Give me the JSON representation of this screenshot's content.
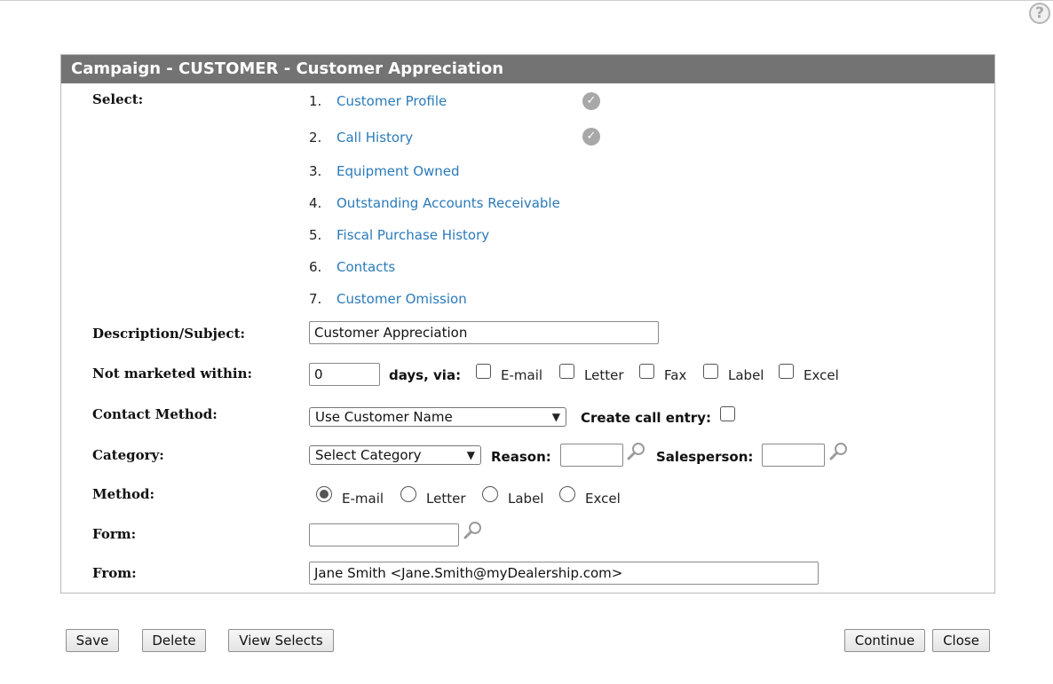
{
  "help": {
    "symbol": "?"
  },
  "panel": {
    "title": "Campaign - CUSTOMER - Customer Appreciation"
  },
  "select": {
    "label": "Select:",
    "items": [
      {
        "num": "1.",
        "label": "Customer Profile",
        "checked": true
      },
      {
        "num": "2.",
        "label": "Call History",
        "checked": true
      },
      {
        "num": "3.",
        "label": "Equipment Owned",
        "checked": false
      },
      {
        "num": "4.",
        "label": "Outstanding Accounts Receivable",
        "checked": false
      },
      {
        "num": "5.",
        "label": "Fiscal Purchase History",
        "checked": false
      },
      {
        "num": "6.",
        "label": "Contacts",
        "checked": false
      },
      {
        "num": "7.",
        "label": "Customer Omission",
        "checked": false
      }
    ]
  },
  "description": {
    "label": "Description/Subject:",
    "value": "Customer Appreciation"
  },
  "not_marketed": {
    "label": "Not marketed within:",
    "value": "0",
    "via_label": "days, via:",
    "options": [
      "E-mail",
      "Letter",
      "Fax",
      "Label",
      "Excel"
    ]
  },
  "contact_method": {
    "label": "Contact Method:",
    "value": "Use Customer Name",
    "create_call_label": "Create call entry:"
  },
  "category": {
    "label": "Category:",
    "value": "Select Category",
    "reason_label": "Reason:",
    "reason_value": "",
    "salesperson_label": "Salesperson:",
    "salesperson_value": ""
  },
  "method": {
    "label": "Method:",
    "options": [
      "E-mail",
      "Letter",
      "Label",
      "Excel"
    ],
    "selected": "E-mail"
  },
  "form": {
    "label": "Form:",
    "value": ""
  },
  "from": {
    "label": "From:",
    "value": "Jane Smith <Jane.Smith@myDealership.com>"
  },
  "buttons": {
    "save": "Save",
    "delete": "Delete",
    "view_selects": "View Selects",
    "continue": "Continue",
    "close": "Close"
  }
}
